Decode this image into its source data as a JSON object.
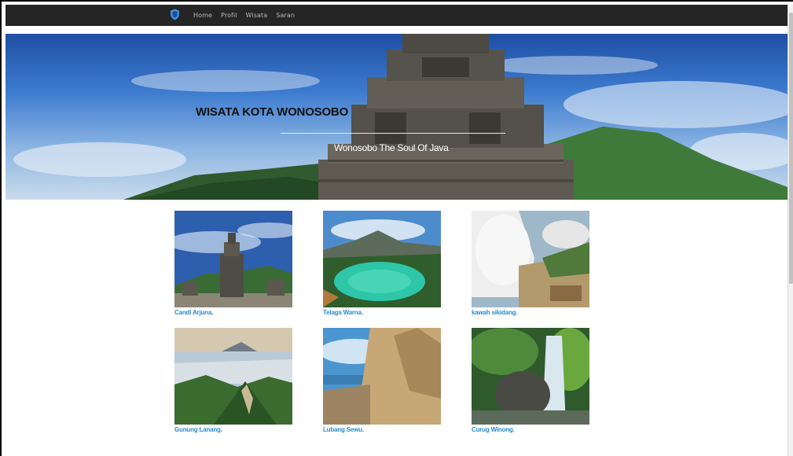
{
  "nav": {
    "items": [
      {
        "label": "Home"
      },
      {
        "label": "Profil"
      },
      {
        "label": "Wisata"
      },
      {
        "label": "Saran"
      }
    ]
  },
  "hero": {
    "title": "WISATA KOTA WONOSOBO",
    "subtitle": "Wonosobo The Soul Of Java"
  },
  "gallery": {
    "items": [
      {
        "caption": "Candi Arjuna."
      },
      {
        "caption": "Telaga Warna."
      },
      {
        "caption": "kawah sikidang."
      },
      {
        "caption": "Gunung Lanang."
      },
      {
        "caption": "Lubang Sewu."
      },
      {
        "caption": "Curug Winong."
      }
    ]
  },
  "colors": {
    "navbar": "#252525",
    "caption": "#2a8bcc",
    "logo": "#3b8fe0"
  }
}
